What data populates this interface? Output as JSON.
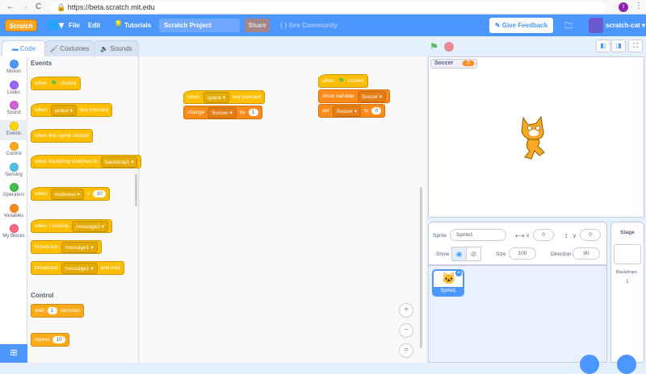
{
  "browser": {
    "url": "https://beta.scratch.mit.edu",
    "back": "←",
    "forward": "→",
    "reload": "C",
    "profile": "I"
  },
  "menubar": {
    "logo": "Scratch",
    "file": "File",
    "edit": "Edit",
    "tutorials": "Tutorials",
    "project_title": "Scratch Project",
    "share": "Share",
    "see_community": "See Community",
    "give_feedback": "Give Feedback",
    "username": "scratch-cat"
  },
  "tabs": [
    {
      "label": "Code"
    },
    {
      "label": "Costumes"
    },
    {
      "label": "Sounds"
    }
  ],
  "categories": [
    {
      "label": "Motion",
      "color": "#4c97ff"
    },
    {
      "label": "Looks",
      "color": "#9966ff"
    },
    {
      "label": "Sound",
      "color": "#cf63cf"
    },
    {
      "label": "Events",
      "color": "#ffd500"
    },
    {
      "label": "Control",
      "color": "#ffab19"
    },
    {
      "label": "Sensing",
      "color": "#4cbfe6"
    },
    {
      "label": "Operators",
      "color": "#40bf4a"
    },
    {
      "label": "Variables",
      "color": "#ff8c1a"
    },
    {
      "label": "My Blocks",
      "color": "#ff6680"
    }
  ],
  "palette": {
    "events_heading": "Events",
    "control_heading": "Control",
    "blocks": [
      {
        "cls": "ev hat",
        "parts": [
          [
            "t",
            "when"
          ],
          [
            "f",
            ""
          ],
          [
            "t",
            "clicked"
          ]
        ]
      },
      {
        "cls": "ev hat",
        "parts": [
          [
            "t",
            "when"
          ],
          [
            "d",
            "space"
          ],
          [
            "t",
            "key pressed"
          ]
        ]
      },
      {
        "cls": "ev hat",
        "parts": [
          [
            "t",
            "when this sprite clicked"
          ]
        ]
      },
      {
        "cls": "ev hat",
        "parts": [
          [
            "t",
            "when backdrop switches to"
          ],
          [
            "d",
            "backdrop1"
          ]
        ]
      },
      {
        "cls": "ev hat",
        "parts": [
          [
            "t",
            "when"
          ],
          [
            "d",
            "loudness"
          ],
          [
            "t",
            ">"
          ],
          [
            "i",
            "10"
          ]
        ]
      },
      {
        "cls": "ev hat",
        "parts": [
          [
            "t",
            "when I receive"
          ],
          [
            "d",
            "message1"
          ]
        ]
      },
      {
        "cls": "ev",
        "parts": [
          [
            "t",
            "broadcast"
          ],
          [
            "d",
            "message1"
          ]
        ]
      },
      {
        "cls": "ev",
        "parts": [
          [
            "t",
            "broadcast"
          ],
          [
            "d",
            "message1"
          ],
          [
            "t",
            "and wait"
          ]
        ]
      },
      {
        "cls": "ctl",
        "parts": [
          [
            "t",
            "wait"
          ],
          [
            "i",
            "1"
          ],
          [
            "t",
            "seconds"
          ]
        ]
      },
      {
        "cls": "ctl",
        "parts": [
          [
            "t",
            "repeat"
          ],
          [
            "i",
            "10"
          ]
        ]
      }
    ]
  },
  "scripts": [
    {
      "cls": "ev hat",
      "parts": [
        [
          "t",
          "when"
        ],
        [
          "d",
          "space"
        ],
        [
          "t",
          "key pressed"
        ]
      ]
    },
    {
      "cls": "var",
      "parts": [
        [
          "t",
          "change"
        ],
        [
          "d",
          "Soccer"
        ],
        [
          "t",
          "by"
        ],
        [
          "i",
          "1"
        ]
      ]
    },
    {
      "cls": "ev hat",
      "parts": [
        [
          "t",
          "when"
        ],
        [
          "f",
          ""
        ],
        [
          "t",
          "clicked"
        ]
      ]
    },
    {
      "cls": "var",
      "parts": [
        [
          "t",
          "show variable"
        ],
        [
          "d",
          "Soccer"
        ]
      ]
    },
    {
      "cls": "var",
      "parts": [
        [
          "t",
          "set"
        ],
        [
          "d",
          "Soccer"
        ],
        [
          "t",
          "to"
        ],
        [
          "i",
          "0"
        ]
      ]
    }
  ],
  "monitor": {
    "name": "Soccer",
    "value": "0"
  },
  "sprite_info": {
    "sprite_label": "Sprite",
    "sprite_name": "Sprite1",
    "x_label": "x",
    "x": "0",
    "y_label": "y",
    "y": "0",
    "show_label": "Show",
    "size_label": "Size",
    "size": "100",
    "direction_label": "Direction",
    "direction": "90"
  },
  "sprites": [
    {
      "name": "Sprite1"
    }
  ],
  "stage_pane": {
    "title": "Stage",
    "backdrops_label": "Backdrops",
    "backdrops_count": "1"
  }
}
